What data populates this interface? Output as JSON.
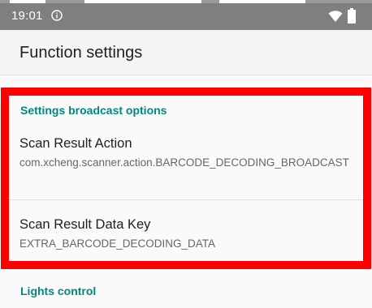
{
  "status_bar": {
    "time": "19:01",
    "icons": [
      "info-icon",
      "wifi-icon",
      "battery-icon"
    ]
  },
  "app_bar": {
    "title": "Function settings"
  },
  "categories": [
    {
      "title": "Settings broadcast options",
      "items": [
        {
          "title": "Scan Result Action",
          "summary": "com.xcheng.scanner.action.BARCODE_DECODING_BROADCAST"
        },
        {
          "title": "Scan Result Data Key",
          "summary": "EXTRA_BARCODE_DECODING_DATA"
        }
      ]
    },
    {
      "title": "Lights control",
      "items": []
    }
  ],
  "colors": {
    "status_bar": "#7f7f7f",
    "accent": "#00897b",
    "highlight": "#ff0000"
  }
}
